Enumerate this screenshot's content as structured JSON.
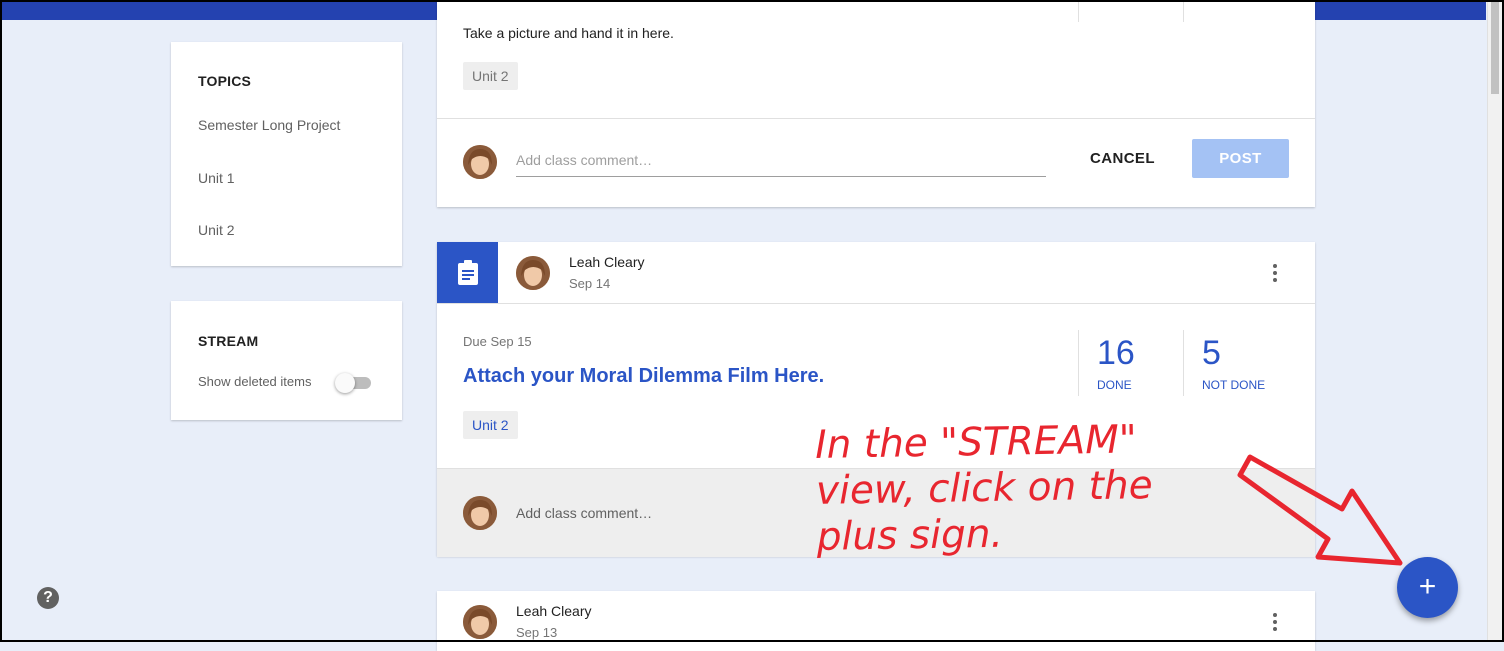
{
  "sidebar": {
    "topics_heading": "TOPICS",
    "topics": [
      "Semester Long Project",
      "Unit 1",
      "Unit 2"
    ],
    "stream_heading": "STREAM",
    "show_deleted_label": "Show deleted items",
    "show_deleted_on": false
  },
  "post1": {
    "instruction": "Take a picture and hand it in here.",
    "topic_chip": "Unit 2",
    "comment_placeholder": "Add class comment…",
    "cancel_label": "CANCEL",
    "post_label": "POST"
  },
  "post2": {
    "author": "Leah Cleary",
    "date": "Sep 14",
    "due": "Due Sep 15",
    "title": "Attach your Moral Dilemma Film Here.",
    "done_count": "16",
    "done_label": "DONE",
    "not_done_count": "5",
    "not_done_label": "NOT DONE",
    "topic_chip": "Unit 2",
    "comment_placeholder": "Add class comment…"
  },
  "post3": {
    "author": "Leah Cleary",
    "date": "Sep 13"
  },
  "annotation": {
    "line1": "In the \"STREAM\"",
    "line2": "view, click on the",
    "line3": "plus sign."
  },
  "fab_symbol": "+",
  "help_symbol": "?",
  "colors": {
    "accent": "#2b55c6",
    "topbar": "#2442b0",
    "annotation": "#e8262f",
    "background": "#e8eef9"
  }
}
